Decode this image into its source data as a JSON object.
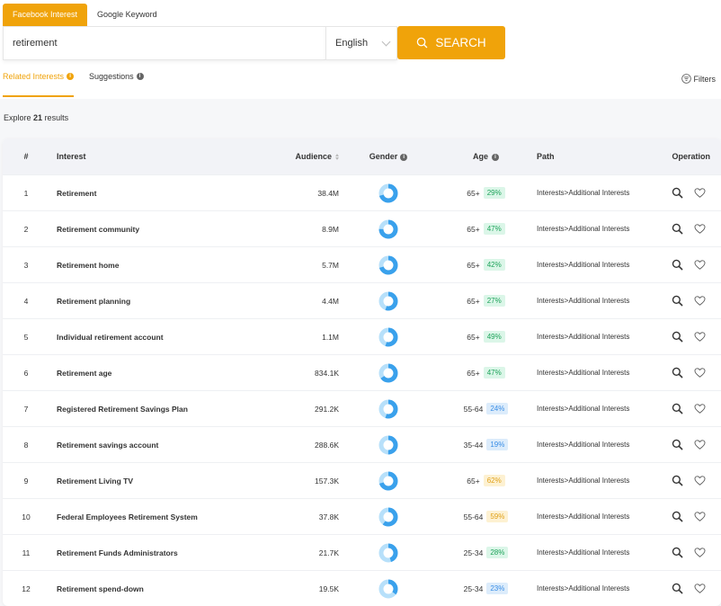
{
  "tabs": [
    {
      "label": "Facebook Interest",
      "active": true
    },
    {
      "label": "Google Keyword",
      "active": false
    }
  ],
  "search": {
    "value": "retirement",
    "language": "English",
    "button_label": "SEARCH"
  },
  "subtabs": [
    {
      "label": "Related Interests",
      "active": true
    },
    {
      "label": "Suggestions",
      "active": false
    }
  ],
  "filters_label": "Filters",
  "explore": {
    "prefix": "Explore",
    "count": "21",
    "suffix": "results"
  },
  "table": {
    "headers": {
      "num": "#",
      "interest": "Interest",
      "audience": "Audience",
      "gender": "Gender",
      "age": "Age",
      "path": "Path",
      "operation": "Operation"
    },
    "rows": [
      {
        "num": "1",
        "interest": "Retirement",
        "audience": "38.4M",
        "female_share": 0.3,
        "age": "65+",
        "pct": "29%",
        "color": "green",
        "path": "Interests>Additional Interests"
      },
      {
        "num": "2",
        "interest": "Retirement community",
        "audience": "8.9M",
        "female_share": 0.25,
        "age": "65+",
        "pct": "47%",
        "color": "green",
        "path": "Interests>Additional Interests"
      },
      {
        "num": "3",
        "interest": "Retirement home",
        "audience": "5.7M",
        "female_share": 0.3,
        "age": "65+",
        "pct": "42%",
        "color": "green",
        "path": "Interests>Additional Interests"
      },
      {
        "num": "4",
        "interest": "Retirement planning",
        "audience": "4.4M",
        "female_share": 0.45,
        "age": "65+",
        "pct": "27%",
        "color": "green",
        "path": "Interests>Additional Interests"
      },
      {
        "num": "5",
        "interest": "Individual retirement account",
        "audience": "1.1M",
        "female_share": 0.45,
        "age": "65+",
        "pct": "49%",
        "color": "green",
        "path": "Interests>Additional Interests"
      },
      {
        "num": "6",
        "interest": "Retirement age",
        "audience": "834.1K",
        "female_share": 0.35,
        "age": "65+",
        "pct": "47%",
        "color": "green",
        "path": "Interests>Additional Interests"
      },
      {
        "num": "7",
        "interest": "Registered Retirement Savings Plan",
        "audience": "291.2K",
        "female_share": 0.45,
        "age": "55-64",
        "pct": "24%",
        "color": "blue",
        "path": "Interests>Additional Interests"
      },
      {
        "num": "8",
        "interest": "Retirement savings account",
        "audience": "288.6K",
        "female_share": 0.5,
        "age": "35-44",
        "pct": "19%",
        "color": "blue",
        "path": "Interests>Additional Interests"
      },
      {
        "num": "9",
        "interest": "Retirement Living TV",
        "audience": "157.3K",
        "female_share": 0.3,
        "age": "65+",
        "pct": "62%",
        "color": "yellow",
        "path": "Interests>Additional Interests"
      },
      {
        "num": "10",
        "interest": "Federal Employees Retirement System",
        "audience": "37.8K",
        "female_share": 0.4,
        "age": "55-64",
        "pct": "59%",
        "color": "yellow",
        "path": "Interests>Additional Interests"
      },
      {
        "num": "11",
        "interest": "Retirement Funds Administrators",
        "audience": "21.7K",
        "female_share": 0.55,
        "age": "25-34",
        "pct": "28%",
        "color": "green",
        "path": "Interests>Additional Interests"
      },
      {
        "num": "12",
        "interest": "Retirement spend-down",
        "audience": "19.5K",
        "female_share": 0.65,
        "age": "25-34",
        "pct": "23%",
        "color": "blue",
        "path": "Interests>Additional Interests"
      }
    ]
  },
  "colors": {
    "accent": "#f0a30a",
    "male": "#3aa1ec",
    "female": "#b7e0fa",
    "green": "#1fa35b",
    "blue": "#3a8ee6",
    "yellow": "#e0a11a"
  }
}
